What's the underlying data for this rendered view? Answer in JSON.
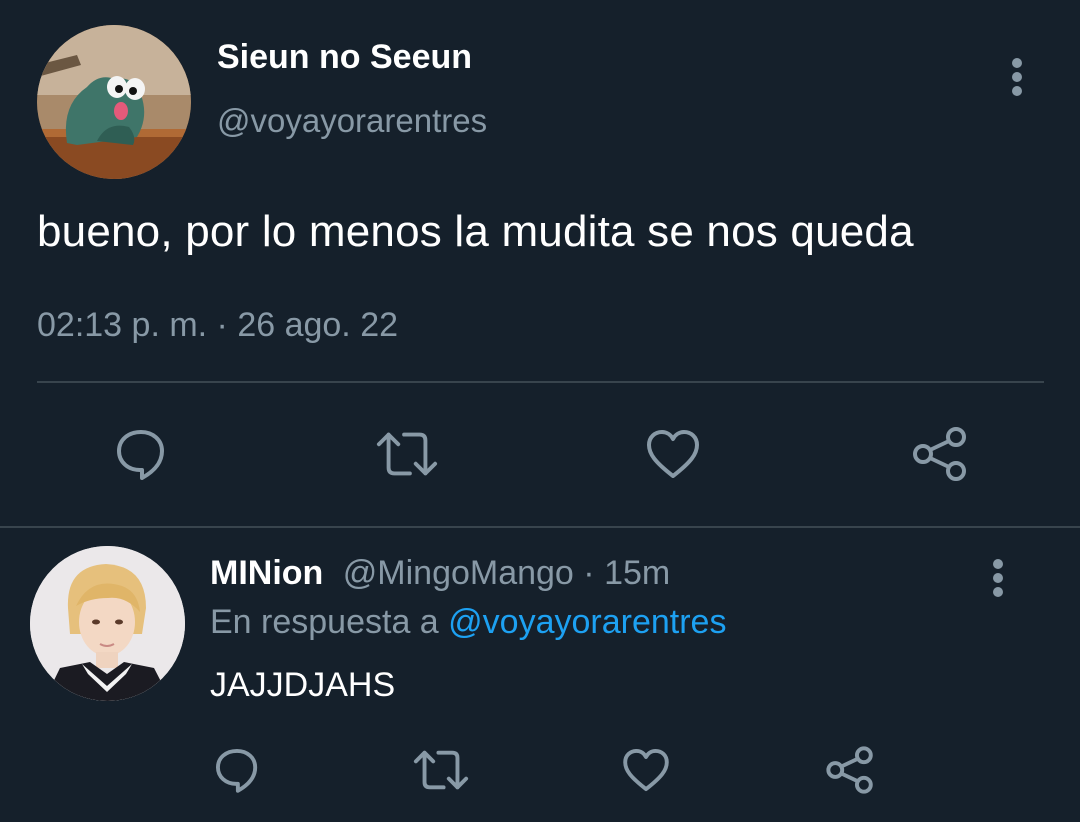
{
  "main_tweet": {
    "display_name": "Sieun no Seeun",
    "handle": "@voyayorarentres",
    "text": "bueno, por lo menos la mudita se nos queda",
    "timestamp": "02:13 p. m. · 26 ago. 22",
    "actions": [
      "reply-icon",
      "retweet-icon",
      "like-icon",
      "share-icon"
    ]
  },
  "reply": {
    "display_name": "MINion",
    "handle": "@MingoMango",
    "separator": "·",
    "time": "15m",
    "reply_to_prefix": "En respuesta a",
    "reply_to_handle": "@voyayorarentres",
    "text": "JAJJDJAHS",
    "actions": [
      "reply-icon",
      "retweet-icon",
      "like-icon",
      "share-icon"
    ]
  },
  "colors": {
    "background": "#15202b",
    "secondary_text": "#8899a6",
    "link": "#1da1f2",
    "divider": "#38444d"
  }
}
